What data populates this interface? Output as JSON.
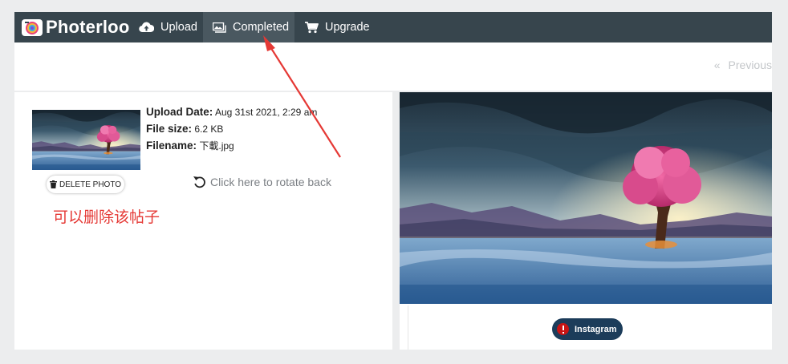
{
  "navbar": {
    "logo_text": "Photerloo",
    "items": [
      {
        "label": "Upload",
        "icon": "cloud-upload-icon"
      },
      {
        "label": "Completed",
        "icon": "photos-icon",
        "active": true
      },
      {
        "label": "Upgrade",
        "icon": "cart-icon"
      }
    ],
    "bg_color": "#37454d"
  },
  "pager": {
    "chevron": "«",
    "prev_label": "Previous"
  },
  "photo": {
    "upload_date_label": "Upload Date:",
    "upload_date": "Aug 31st 2021, 2:29 am",
    "file_size_label": "File size:",
    "file_size": "6.2 KB",
    "filename_label": "Filename:",
    "filename": "下載.jpg",
    "delete_label": "DELETE PHOTO",
    "rotate_label": "Click here to rotate back"
  },
  "annotation": {
    "text": "可以删除该帖子",
    "color": "#e53935"
  },
  "share": {
    "instagram_label": "Instagram",
    "button_color": "#1c3c5a"
  }
}
